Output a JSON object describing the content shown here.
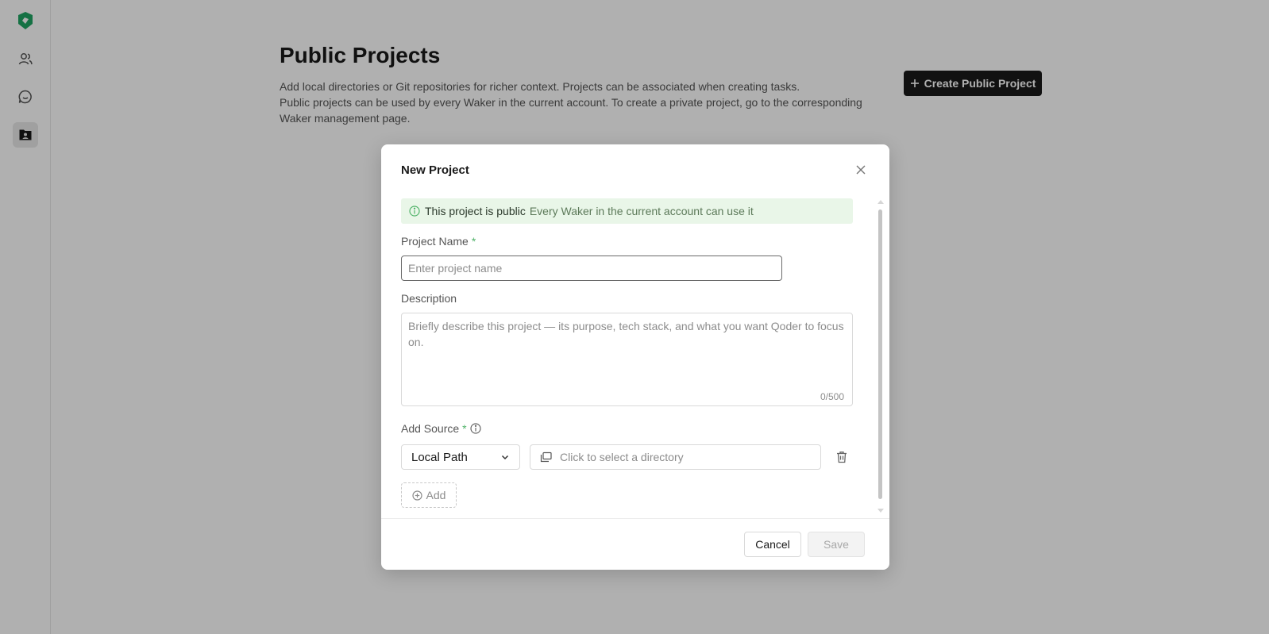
{
  "app": {
    "nav": [
      {
        "icon": "app-logo-icon",
        "active": false
      },
      {
        "icon": "users-icon",
        "active": false
      },
      {
        "icon": "chat-icon",
        "active": false
      },
      {
        "icon": "project-folder-icon",
        "active": true
      }
    ]
  },
  "page": {
    "title": "Public Projects",
    "description_line1": "Add local directories or Git repositories for richer context. Projects can be associated when creating tasks.",
    "description_line2": "Public projects can be used by every Waker in the current account. To create a private project, go to the corresponding Waker management page.",
    "create_button_label": "Create Public Project",
    "create_button_icon": "plus-icon"
  },
  "modal": {
    "title": "New Project",
    "notice": {
      "icon": "info-circle-icon",
      "strong": "This project is public",
      "sub": "Every Waker in the current account can use it"
    },
    "project_name": {
      "label": "Project Name",
      "required_mark": "*",
      "value": "",
      "placeholder": "Enter project name"
    },
    "description": {
      "label": "Description",
      "value": "",
      "placeholder": "Briefly describe this project — its purpose, tech stack, and what you want Qoder to focus on.",
      "counter": "0/500"
    },
    "source": {
      "label": "Add Source",
      "required_mark": "*",
      "info_icon": "info-circle-icon",
      "type_selected": "Local Path",
      "directory_placeholder": "Click to select a directory",
      "add_label": "Add"
    },
    "footer": {
      "cancel_label": "Cancel",
      "save_label": "Save"
    }
  },
  "colors": {
    "accent_dark": "#1a1a1a",
    "notice_bg": "#e9f6e8",
    "required": "#52b36a",
    "logo_green": "#1fa463"
  }
}
